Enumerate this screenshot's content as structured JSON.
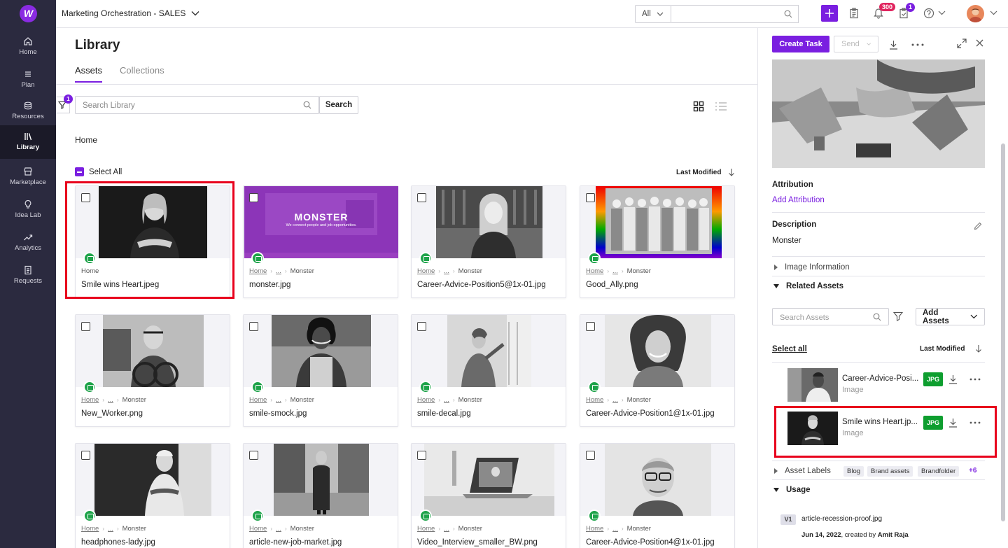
{
  "sidebar": {
    "logo": "W",
    "items": [
      {
        "label": "Home",
        "icon": "home-icon"
      },
      {
        "label": "Plan",
        "icon": "list-icon"
      },
      {
        "label": "Resources",
        "icon": "database-icon"
      },
      {
        "label": "Library",
        "icon": "library-icon",
        "active": true
      },
      {
        "label": "Marketplace",
        "icon": "store-icon"
      },
      {
        "label": "Idea Lab",
        "icon": "lightbulb-icon"
      },
      {
        "label": "Analytics",
        "icon": "trend-icon"
      },
      {
        "label": "Requests",
        "icon": "document-icon"
      }
    ]
  },
  "topbar": {
    "workspace": "Marketing Orchestration - SALES",
    "search_scope": "All",
    "search_value": "",
    "notifications_count": "300",
    "tasks_count": "1"
  },
  "library": {
    "title": "Library",
    "tabs": [
      "Assets",
      "Collections"
    ],
    "filter_count": "1",
    "search_placeholder": "Search Library",
    "search_button": "Search",
    "breadcrumb": "Home",
    "select_all": "Select All",
    "sort_label": "Last Modified",
    "assets": [
      {
        "name": "Smile wins Heart.jpeg",
        "crumbs": [
          "Home"
        ]
      },
      {
        "name": "monster.jpg",
        "crumbs": [
          "Home",
          "...",
          "Monster"
        ]
      },
      {
        "name": "Career-Advice-Position5@1x-01.jpg",
        "crumbs": [
          "Home",
          "...",
          "Monster"
        ]
      },
      {
        "name": "Good_Ally.png",
        "crumbs": [
          "Home",
          "...",
          "Monster"
        ]
      },
      {
        "name": "New_Worker.png",
        "crumbs": [
          "Home",
          "...",
          "Monster"
        ]
      },
      {
        "name": "smile-smock.jpg",
        "crumbs": [
          "Home",
          "...",
          "Monster"
        ]
      },
      {
        "name": "smile-decal.jpg",
        "crumbs": [
          "Home",
          "...",
          "Monster"
        ]
      },
      {
        "name": "Career-Advice-Position1@1x-01.jpg",
        "crumbs": [
          "Home",
          "...",
          "Monster"
        ]
      },
      {
        "name": "headphones-lady.jpg",
        "crumbs": [
          "Home",
          "...",
          "Monster"
        ]
      },
      {
        "name": "article-new-job-market.jpg",
        "crumbs": [
          "Home",
          "...",
          "Monster"
        ]
      },
      {
        "name": "Video_Interview_smaller_BW.png",
        "crumbs": [
          "Home",
          "...",
          "Monster"
        ]
      },
      {
        "name": "Career-Advice-Position4@1x-01.jpg",
        "crumbs": [
          "Home",
          "...",
          "Monster"
        ]
      }
    ],
    "monster_banner": {
      "logo": "MONSTER",
      "tagline": "We connect people and job opportunities."
    }
  },
  "panel": {
    "create_task": "Create Task",
    "send": "Send",
    "attribution_label": "Attribution",
    "add_attribution": "Add Attribution",
    "description_label": "Description",
    "description_value": "Monster",
    "image_information": "Image Information",
    "related_assets": "Related Assets",
    "search_assets_placeholder": "Search Assets",
    "add_assets": "Add Assets",
    "select_all": "Select all",
    "sort_label": "Last Modified",
    "related": [
      {
        "name": "Career-Advice-Posi...",
        "type": "Image",
        "format": "JPG"
      },
      {
        "name": "Smile wins Heart.jp...",
        "type": "Image",
        "format": "JPG"
      }
    ],
    "asset_labels": "Asset Labels",
    "labels": [
      "Blog",
      "Brand assets",
      "Brandfolder"
    ],
    "labels_more": "+6",
    "usage": "Usage",
    "usage_item": {
      "version": "V1",
      "file": "article-recession-proof.jpg",
      "date": "Jun 14, 2022",
      "created_by_prefix": ", created by ",
      "author": "Amit Raja"
    }
  },
  "colors": {
    "accent": "#7a1fe0",
    "sidebar": "#2b2a3f",
    "highlight": "#e8001c",
    "image_badge": "#1ea34a",
    "jpg_badge": "#0e9e2f"
  }
}
